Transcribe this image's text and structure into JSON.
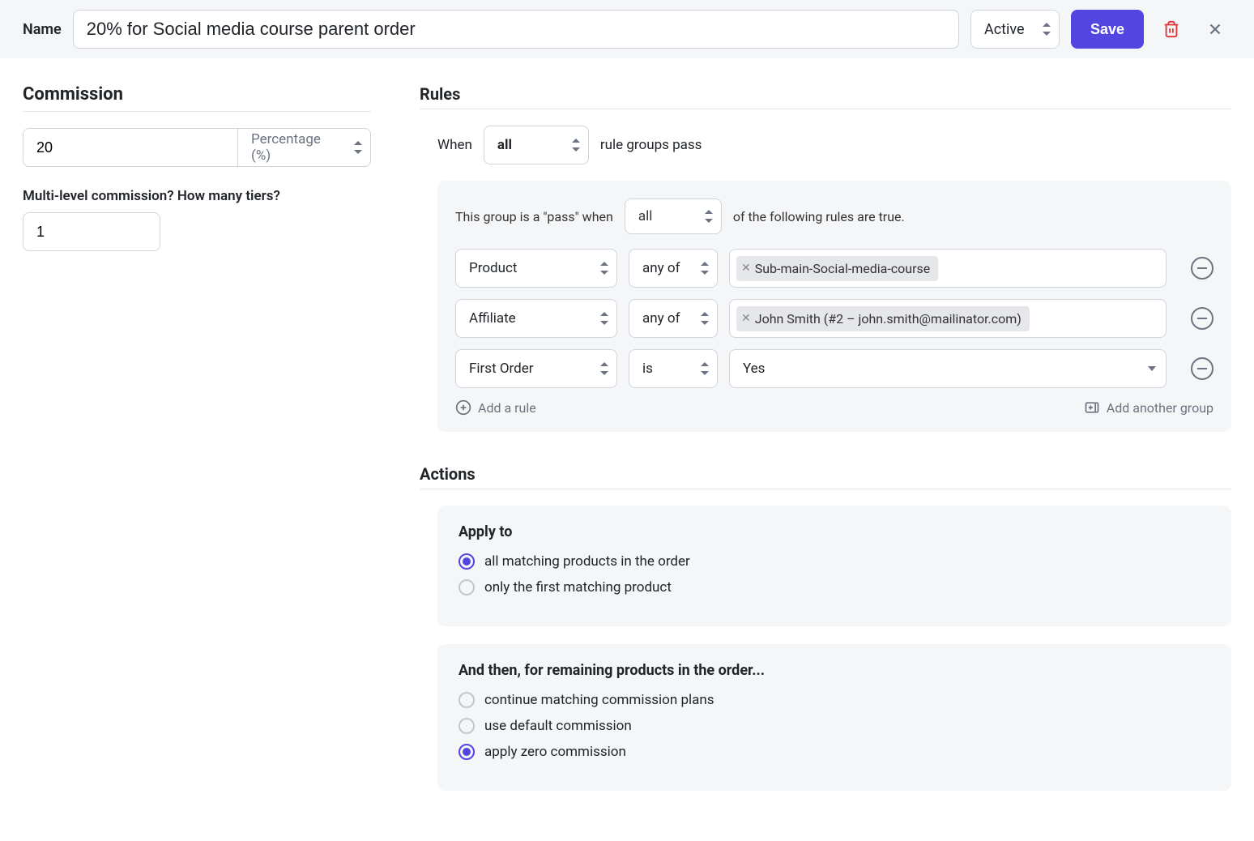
{
  "header": {
    "name_label": "Name",
    "name_value": "20% for Social media course parent order",
    "status": "Active",
    "save_label": "Save"
  },
  "commission": {
    "title": "Commission",
    "value": "20",
    "type": "Percentage (%)",
    "tiers_label": "Multi-level commission? How many tiers?",
    "tiers_value": "1"
  },
  "rules": {
    "title": "Rules",
    "when_prefix": "When",
    "when_mode": "all",
    "when_suffix": "rule groups pass",
    "group_intro_prefix": "This group is a \"pass\" when",
    "group_mode": "all",
    "group_intro_suffix": "of the following rules are true.",
    "rows": [
      {
        "field": "Product",
        "op": "any of",
        "tags": [
          "Sub-main-Social-media-course"
        ]
      },
      {
        "field": "Affiliate",
        "op": "any of",
        "tags": [
          "John Smith (#2 – john.smith@mailinator.com)"
        ]
      },
      {
        "field": "First Order",
        "op": "is",
        "value": "Yes"
      }
    ],
    "add_rule_label": "Add a rule",
    "add_group_label": "Add another group"
  },
  "actions": {
    "title": "Actions",
    "apply_to_title": "Apply to",
    "apply_to_options": [
      {
        "label": "all matching products in the order",
        "checked": true
      },
      {
        "label": "only the first matching product",
        "checked": false
      }
    ],
    "remaining_title": "And then, for remaining products in the order...",
    "remaining_options": [
      {
        "label": "continue matching commission plans",
        "checked": false
      },
      {
        "label": "use default commission",
        "checked": false
      },
      {
        "label": "apply zero commission",
        "checked": true
      }
    ]
  }
}
